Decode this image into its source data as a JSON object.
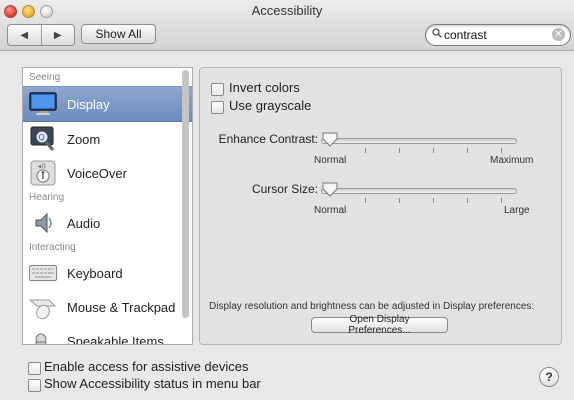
{
  "window": {
    "title": "Accessibility"
  },
  "toolbar": {
    "back_icon": "back-triangle-icon",
    "forward_icon": "forward-triangle-icon",
    "show_all_label": "Show All",
    "search": {
      "value": "contrast",
      "icon": "magnifier-icon",
      "clear_icon": "clear-x-icon"
    }
  },
  "sidebar": {
    "groups": {
      "seeing": "Seeing",
      "hearing": "Hearing",
      "interacting": "Interacting"
    },
    "items": [
      {
        "label": "Display",
        "icon": "display-icon",
        "selected": true
      },
      {
        "label": "Zoom",
        "icon": "zoom-icon",
        "selected": false
      },
      {
        "label": "VoiceOver",
        "icon": "voiceover-icon",
        "selected": false
      },
      {
        "label": "Audio",
        "icon": "audio-speaker-icon",
        "selected": false
      },
      {
        "label": "Keyboard",
        "icon": "keyboard-icon",
        "selected": false
      },
      {
        "label": "Mouse & Trackpad",
        "icon": "mouse-trackpad-icon",
        "selected": false
      },
      {
        "label": "Speakable Items",
        "icon": "speakable-items-icon",
        "selected": false
      }
    ]
  },
  "display_panel": {
    "invert_colors_label": "Invert colors",
    "invert_colors_checked": false,
    "use_grayscale_label": "Use grayscale",
    "use_grayscale_checked": false,
    "enhance_contrast": {
      "label": "Enhance Contrast:",
      "min_label": "Normal",
      "max_label": "Maximum",
      "level": 0
    },
    "cursor_size": {
      "label": "Cursor Size:",
      "min_label": "Normal",
      "max_label": "Large",
      "level": 0
    },
    "note": "Display resolution and brightness can be adjusted in Display preferences:",
    "open_prefs_button_label": "Open Display Preferences..."
  },
  "footer": {
    "enable_assistive_label": "Enable access for assistive devices",
    "enable_assistive_checked": false,
    "show_status_label": "Show Accessibility status in menu bar",
    "show_status_checked": false,
    "help_label": "?"
  },
  "colors": {
    "selection": "#7b98c9",
    "panel_bg": "#e2e2e2",
    "window_bg": "#e8e8e8"
  }
}
